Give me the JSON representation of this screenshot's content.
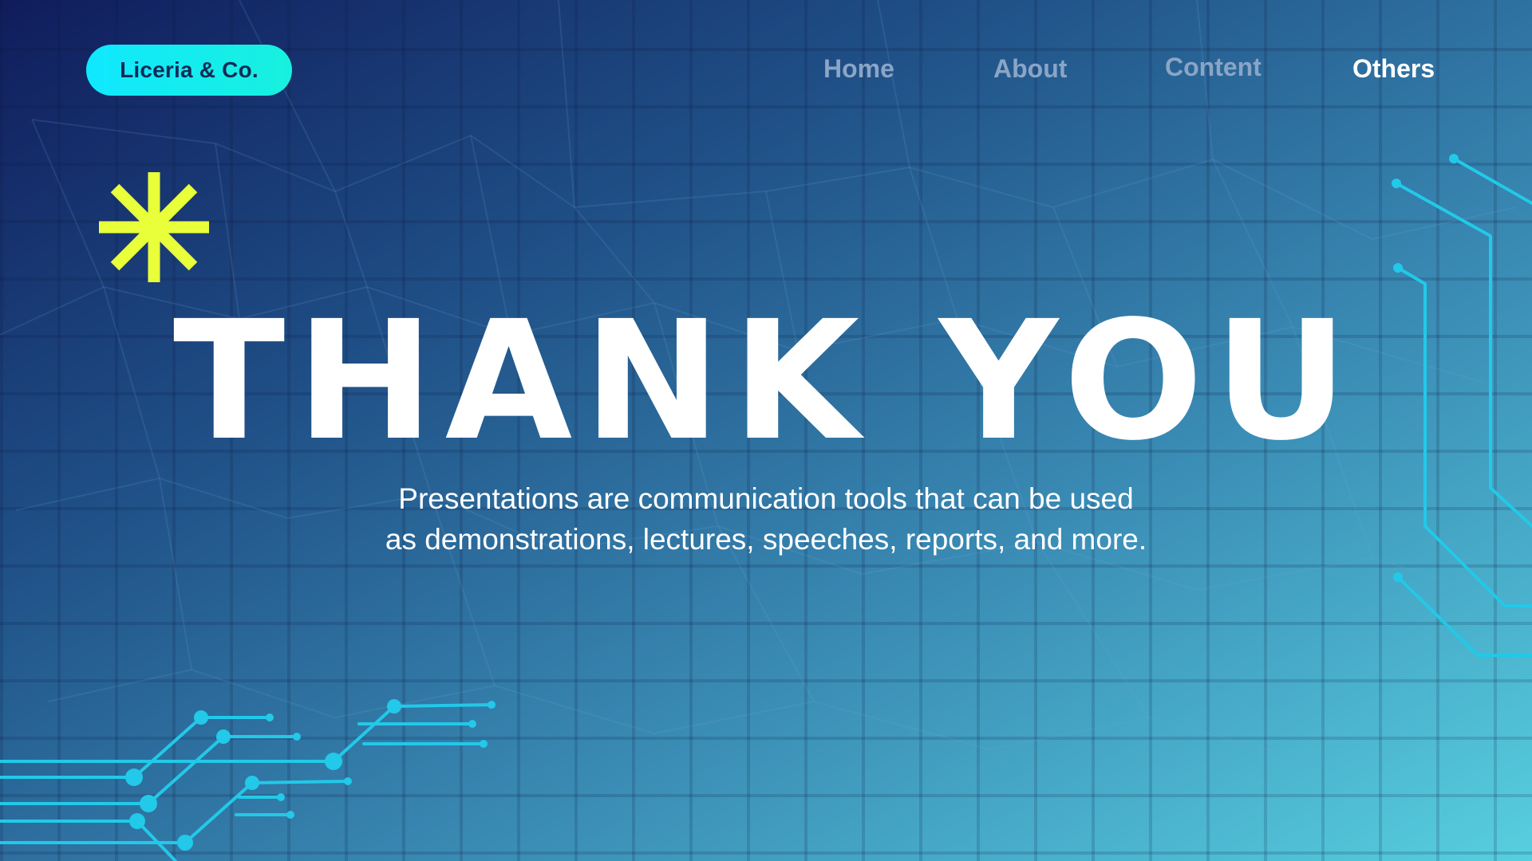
{
  "brand": {
    "name": "Liceria & Co."
  },
  "nav": {
    "items": [
      {
        "label": "Home",
        "active": false
      },
      {
        "label": "About",
        "active": false
      },
      {
        "label": "Content",
        "active": false
      },
      {
        "label": "Others",
        "active": true
      }
    ]
  },
  "hero": {
    "title": "THANK YOU",
    "subtitle": "Presentations are communication tools that can be used as demonstrations, lectures, speeches, reports, and more."
  },
  "icons": {
    "decoration": "asterisk-icon",
    "circuits": "circuit-lines-decoration"
  },
  "colors": {
    "accent_pill": "#10e8ff",
    "asterisk": "#e8ff3a",
    "circuit": "#22c9e8",
    "nav_inactive": "#8aa5c6",
    "nav_active": "#ffffff",
    "text": "#ffffff"
  }
}
